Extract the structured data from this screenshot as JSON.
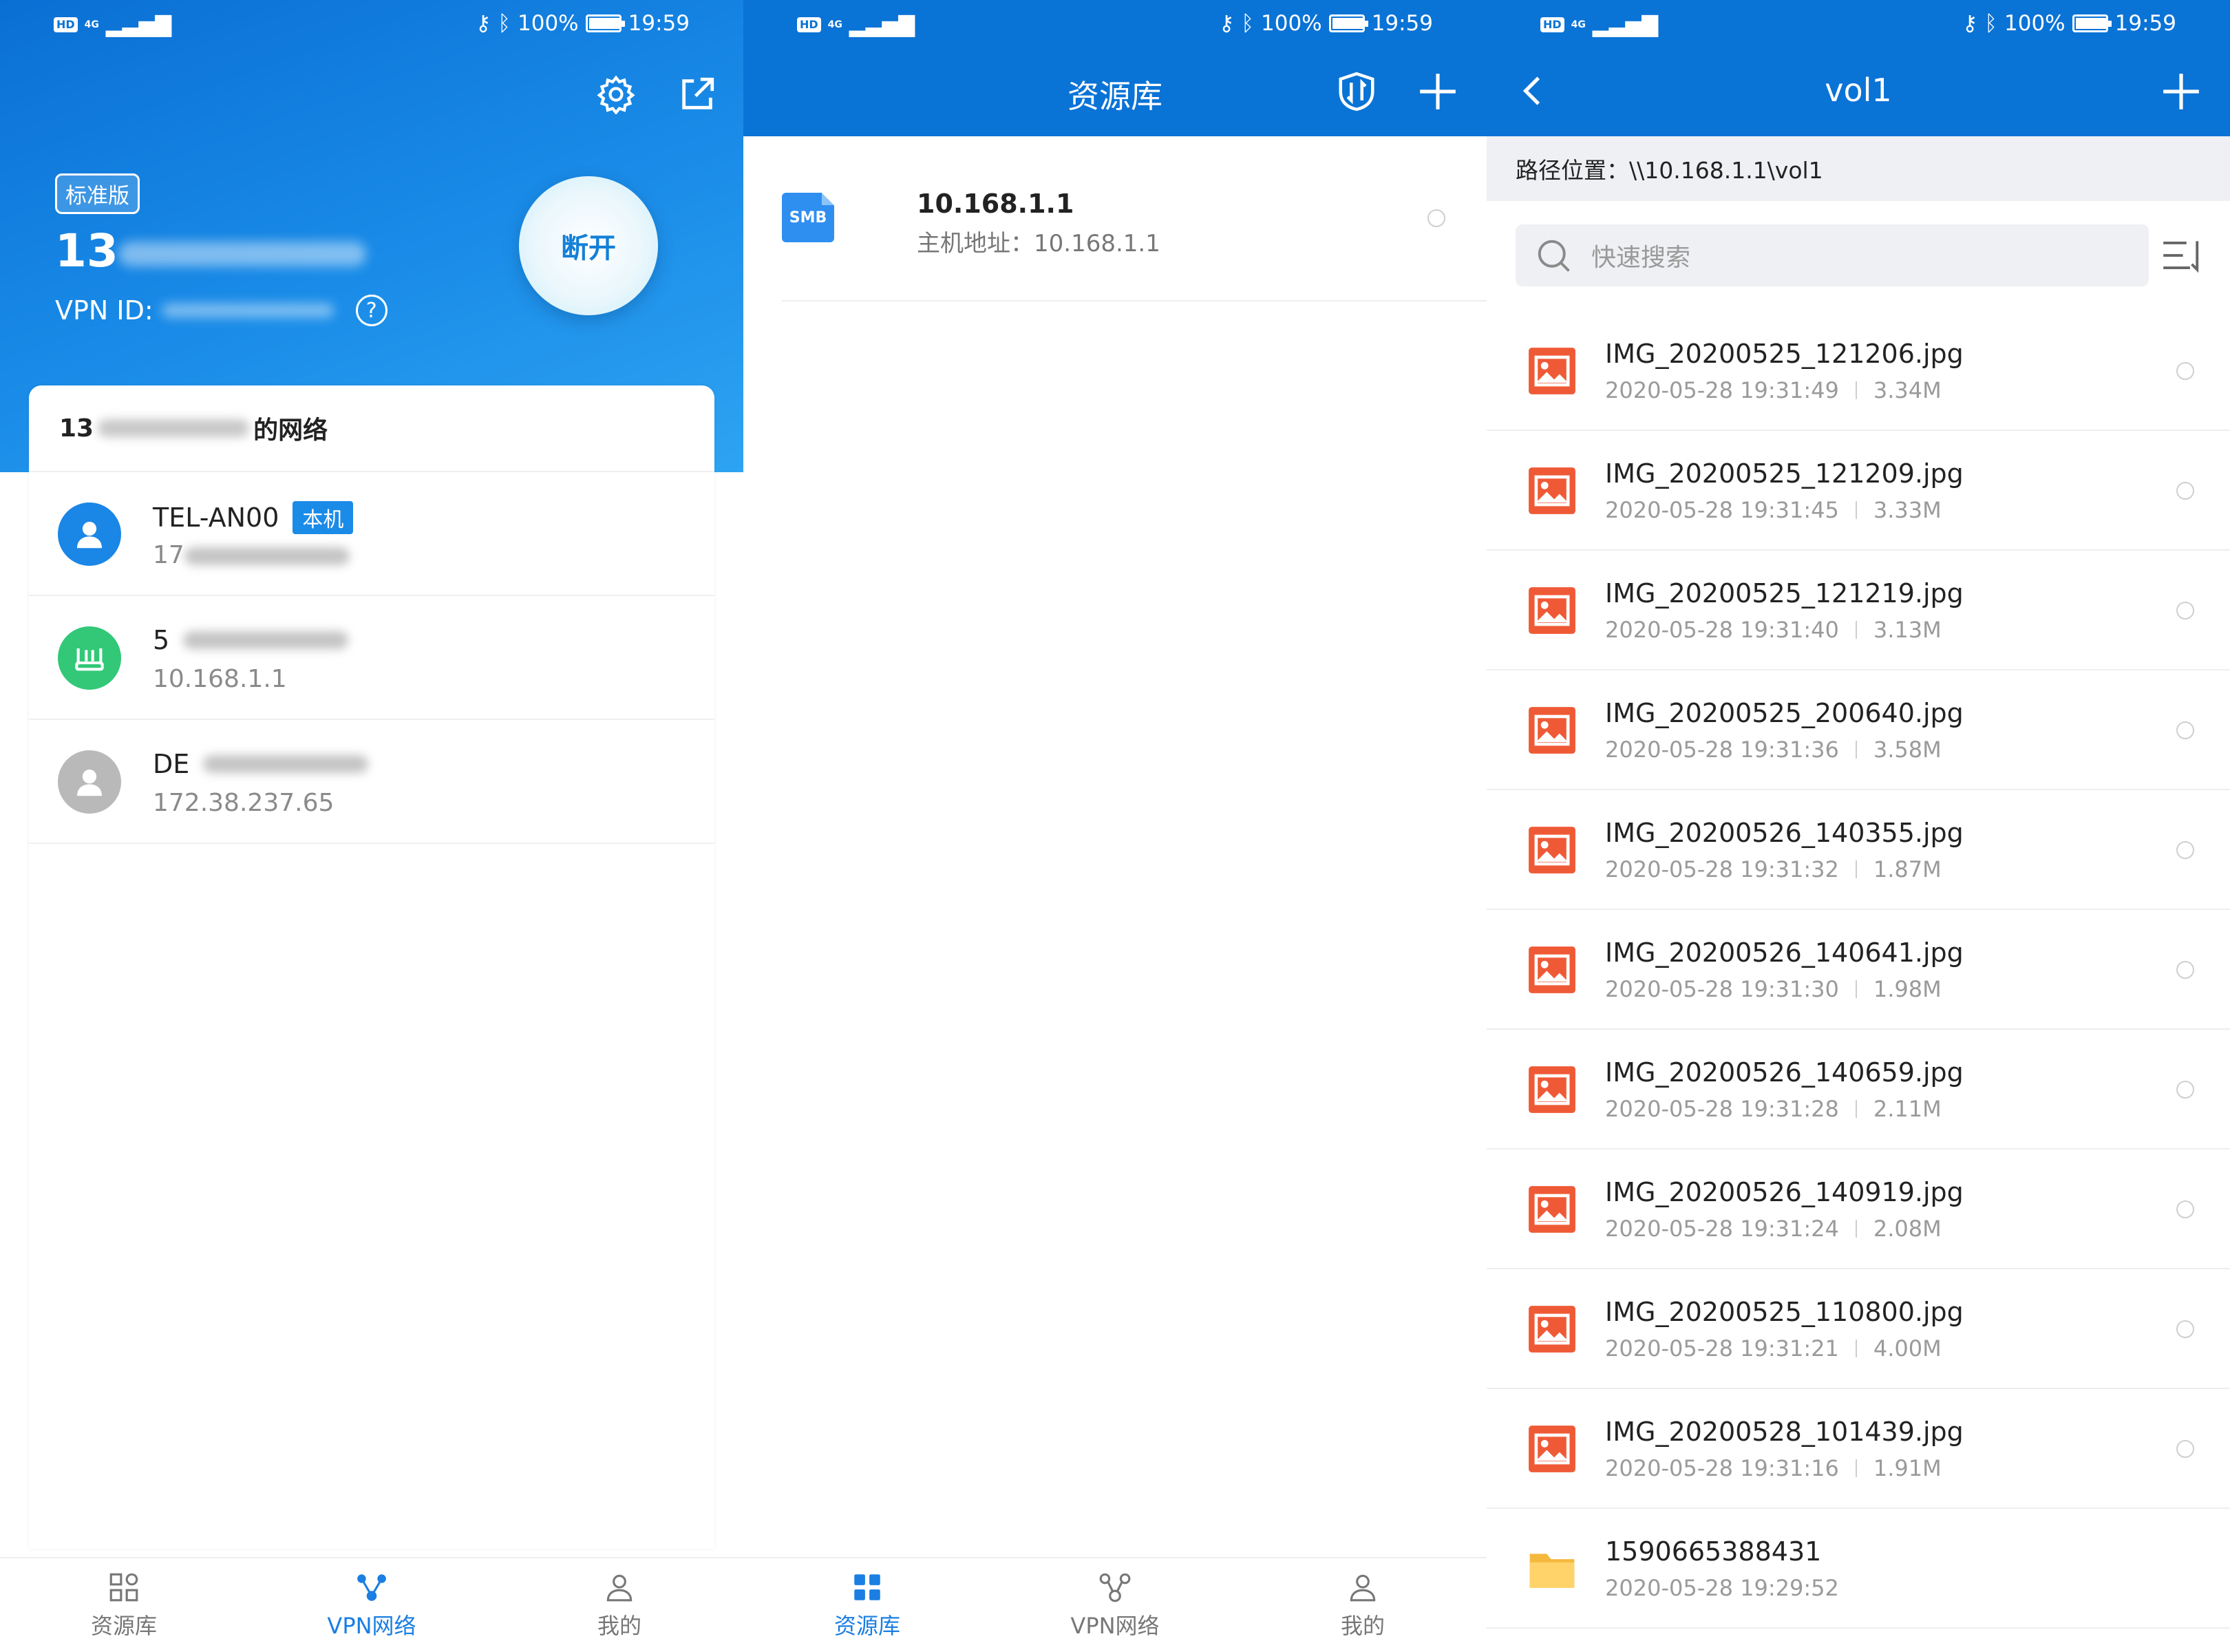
{
  "status": {
    "time": "19:59",
    "battery": "100%",
    "hd": "HD",
    "signal": "4G"
  },
  "vpn_screen": {
    "edition_badge": "标准版",
    "account_prefix": "13",
    "vpn_id_label": "VPN ID: ",
    "help_symbol": "?",
    "disconnect_label": "断开",
    "network_prefix": "13",
    "network_suffix": "的网络",
    "devices": [
      {
        "name": "TEL-AN00",
        "tag": "本机",
        "ip": "17"
      },
      {
        "name": "5",
        "tag": "",
        "ip": "10.168.1.1"
      },
      {
        "name": "DE",
        "tag": "",
        "ip": "172.38.237.65"
      }
    ],
    "tabs": [
      "资源库",
      "VPN网络",
      "我的"
    ]
  },
  "library_screen": {
    "title": "资源库",
    "resource": {
      "type_label": "SMB",
      "name": "10.168.1.1",
      "address": "主机地址：10.168.1.1"
    },
    "tabs": [
      "资源库",
      "VPN网络",
      "我的"
    ]
  },
  "folder_screen": {
    "title": "vol1",
    "path": "路径位置：\\\\10.168.1.1\\vol1",
    "search_placeholder": "快速搜索",
    "files": [
      {
        "name": "IMG_20200525_121206.jpg",
        "date": "2020-05-28 19:31:49",
        "size": "3.34M"
      },
      {
        "name": "IMG_20200525_121209.jpg",
        "date": "2020-05-28 19:31:45",
        "size": "3.33M"
      },
      {
        "name": "IMG_20200525_121219.jpg",
        "date": "2020-05-28 19:31:40",
        "size": "3.13M"
      },
      {
        "name": "IMG_20200525_200640.jpg",
        "date": "2020-05-28 19:31:36",
        "size": "3.58M"
      },
      {
        "name": "IMG_20200526_140355.jpg",
        "date": "2020-05-28 19:31:32",
        "size": "1.87M"
      },
      {
        "name": "IMG_20200526_140641.jpg",
        "date": "2020-05-28 19:31:30",
        "size": "1.98M"
      },
      {
        "name": "IMG_20200526_140659.jpg",
        "date": "2020-05-28 19:31:28",
        "size": "2.11M"
      },
      {
        "name": "IMG_20200526_140919.jpg",
        "date": "2020-05-28 19:31:24",
        "size": "2.08M"
      },
      {
        "name": "IMG_20200525_110800.jpg",
        "date": "2020-05-28 19:31:21",
        "size": "4.00M"
      },
      {
        "name": "IMG_20200528_101439.jpg",
        "date": "2020-05-28 19:31:16",
        "size": "1.91M"
      }
    ],
    "folder": {
      "name": "1590665388431",
      "date": "2020-05-28 19:29:52"
    }
  },
  "colors": {
    "primary": "#0a73d6",
    "accent": "#1a7ee2",
    "image_icon": "#ef5a36",
    "folder_icon": "#f5b83d"
  },
  "icons": [
    "settings-icon",
    "share-icon",
    "transfer-icon",
    "plus-icon",
    "back-icon",
    "search-icon",
    "sort-icon",
    "image-file-icon",
    "folder-icon"
  ]
}
